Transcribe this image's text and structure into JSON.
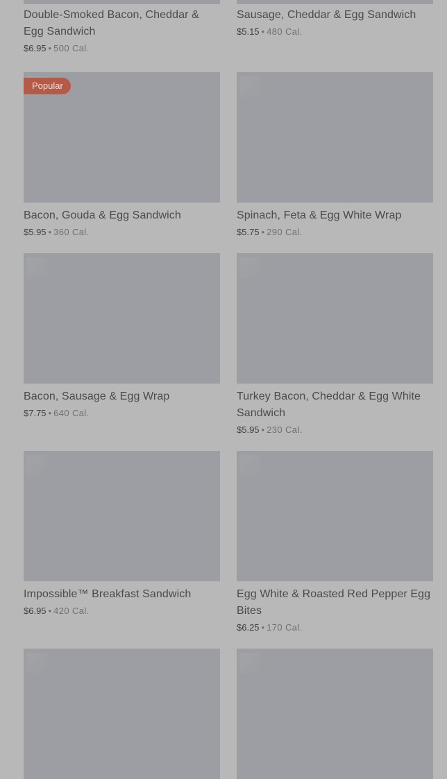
{
  "badge_popular": "Popular",
  "items": [
    {
      "name": "Double-Smoked Bacon, Cheddar & Egg Sandwich",
      "price": "$6.95",
      "sep": "•",
      "calories": "500 Cal."
    },
    {
      "name": "Sausage, Cheddar & Egg Sandwich",
      "price": "$5.15",
      "sep": "•",
      "calories": "480 Cal."
    },
    {
      "name": "Bacon, Gouda & Egg Sandwich",
      "price": "$5.95",
      "sep": "•",
      "calories": "360 Cal."
    },
    {
      "name": "Spinach, Feta & Egg White Wrap",
      "price": "$5.75",
      "sep": "•",
      "calories": "290 Cal."
    },
    {
      "name": "Bacon, Sausage & Egg Wrap",
      "price": "$7.75",
      "sep": "•",
      "calories": "640 Cal."
    },
    {
      "name": "Turkey Bacon, Cheddar & Egg White Sandwich",
      "price": "$5.95",
      "sep": "•",
      "calories": "230 Cal."
    },
    {
      "name": "Impossible™ Breakfast Sandwich",
      "price": "$6.95",
      "sep": "•",
      "calories": "420 Cal."
    },
    {
      "name": "Egg White & Roasted Red Pepper Egg Bites",
      "price": "$6.25",
      "sep": "•",
      "calories": "170 Cal."
    }
  ]
}
